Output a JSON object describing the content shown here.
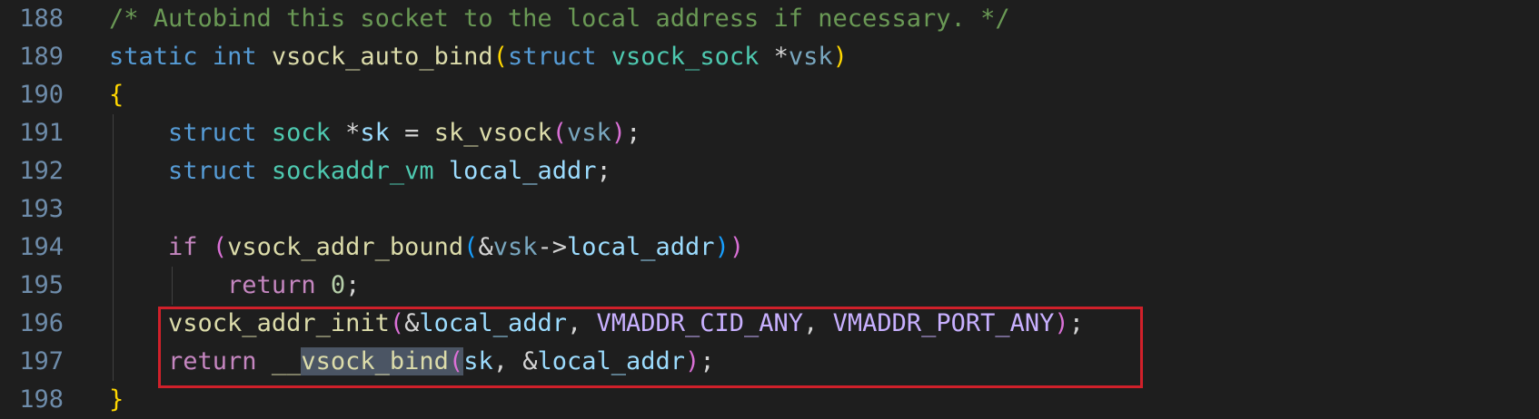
{
  "editor": {
    "lines": [
      {
        "num": "188",
        "tokens": [
          {
            "t": "/* Autobind this socket to the local address if necessary. */",
            "c": "comment"
          }
        ]
      },
      {
        "num": "189",
        "tokens": [
          {
            "t": "static",
            "c": "keyword"
          },
          {
            "t": " ",
            "c": "punct"
          },
          {
            "t": "int",
            "c": "keyword"
          },
          {
            "t": " ",
            "c": "punct"
          },
          {
            "t": "vsock_auto_bind",
            "c": "func"
          },
          {
            "t": "(",
            "c": "brace"
          },
          {
            "t": "struct",
            "c": "keyword"
          },
          {
            "t": " ",
            "c": "punct"
          },
          {
            "t": "vsock_sock",
            "c": "type"
          },
          {
            "t": " ",
            "c": "punct"
          },
          {
            "t": "*",
            "c": "op"
          },
          {
            "t": "vsk",
            "c": "param"
          },
          {
            "t": ")",
            "c": "brace"
          }
        ]
      },
      {
        "num": "190",
        "tokens": [
          {
            "t": "{",
            "c": "brace"
          }
        ]
      },
      {
        "num": "191",
        "tokens": [
          {
            "t": "    ",
            "c": "punct"
          },
          {
            "t": "struct",
            "c": "keyword"
          },
          {
            "t": " ",
            "c": "punct"
          },
          {
            "t": "sock",
            "c": "type"
          },
          {
            "t": " ",
            "c": "punct"
          },
          {
            "t": "*",
            "c": "op"
          },
          {
            "t": "sk",
            "c": "var"
          },
          {
            "t": " = ",
            "c": "op"
          },
          {
            "t": "sk_vsock",
            "c": "func"
          },
          {
            "t": "(",
            "c": "paren"
          },
          {
            "t": "vsk",
            "c": "param"
          },
          {
            "t": ")",
            "c": "paren"
          },
          {
            "t": ";",
            "c": "punct"
          }
        ]
      },
      {
        "num": "192",
        "tokens": [
          {
            "t": "    ",
            "c": "punct"
          },
          {
            "t": "struct",
            "c": "keyword"
          },
          {
            "t": " ",
            "c": "punct"
          },
          {
            "t": "sockaddr_vm",
            "c": "type"
          },
          {
            "t": " ",
            "c": "punct"
          },
          {
            "t": "local_addr",
            "c": "var"
          },
          {
            "t": ";",
            "c": "punct"
          }
        ]
      },
      {
        "num": "193",
        "tokens": []
      },
      {
        "num": "194",
        "tokens": [
          {
            "t": "    ",
            "c": "punct"
          },
          {
            "t": "if",
            "c": "control"
          },
          {
            "t": " ",
            "c": "punct"
          },
          {
            "t": "(",
            "c": "paren"
          },
          {
            "t": "vsock_addr_bound",
            "c": "func"
          },
          {
            "t": "(",
            "c": "paren2"
          },
          {
            "t": "&",
            "c": "op"
          },
          {
            "t": "vsk",
            "c": "param"
          },
          {
            "t": "->",
            "c": "op"
          },
          {
            "t": "local_addr",
            "c": "var"
          },
          {
            "t": ")",
            "c": "paren2"
          },
          {
            "t": ")",
            "c": "paren"
          }
        ]
      },
      {
        "num": "195",
        "tokens": [
          {
            "t": "        ",
            "c": "punct"
          },
          {
            "t": "return",
            "c": "control"
          },
          {
            "t": " ",
            "c": "punct"
          },
          {
            "t": "0",
            "c": "number"
          },
          {
            "t": ";",
            "c": "punct"
          }
        ]
      },
      {
        "num": "196",
        "tokens": [
          {
            "t": "    ",
            "c": "punct"
          },
          {
            "t": "vsock_addr_init",
            "c": "func"
          },
          {
            "t": "(",
            "c": "paren"
          },
          {
            "t": "&",
            "c": "op"
          },
          {
            "t": "local_addr",
            "c": "var"
          },
          {
            "t": ", ",
            "c": "punct"
          },
          {
            "t": "VMADDR_CID_ANY",
            "c": "const"
          },
          {
            "t": ", ",
            "c": "punct"
          },
          {
            "t": "VMADDR_PORT_ANY",
            "c": "const"
          },
          {
            "t": ")",
            "c": "paren"
          },
          {
            "t": ";",
            "c": "punct"
          }
        ]
      },
      {
        "num": "197",
        "tokens": [
          {
            "t": "    ",
            "c": "punct"
          },
          {
            "t": "return",
            "c": "control"
          },
          {
            "t": " ",
            "c": "punct"
          },
          {
            "t": "__",
            "c": "func"
          },
          {
            "t": "vsock_bind",
            "c": "func",
            "sel": true
          },
          {
            "t": "(",
            "c": "paren",
            "sel": true
          },
          {
            "t": "sk",
            "c": "var"
          },
          {
            "t": ", ",
            "c": "punct"
          },
          {
            "t": "&",
            "c": "op"
          },
          {
            "t": "local_addr",
            "c": "var"
          },
          {
            "t": ")",
            "c": "paren"
          },
          {
            "t": ";",
            "c": "punct"
          }
        ]
      },
      {
        "num": "198",
        "tokens": [
          {
            "t": "}",
            "c": "brace"
          }
        ]
      }
    ]
  }
}
